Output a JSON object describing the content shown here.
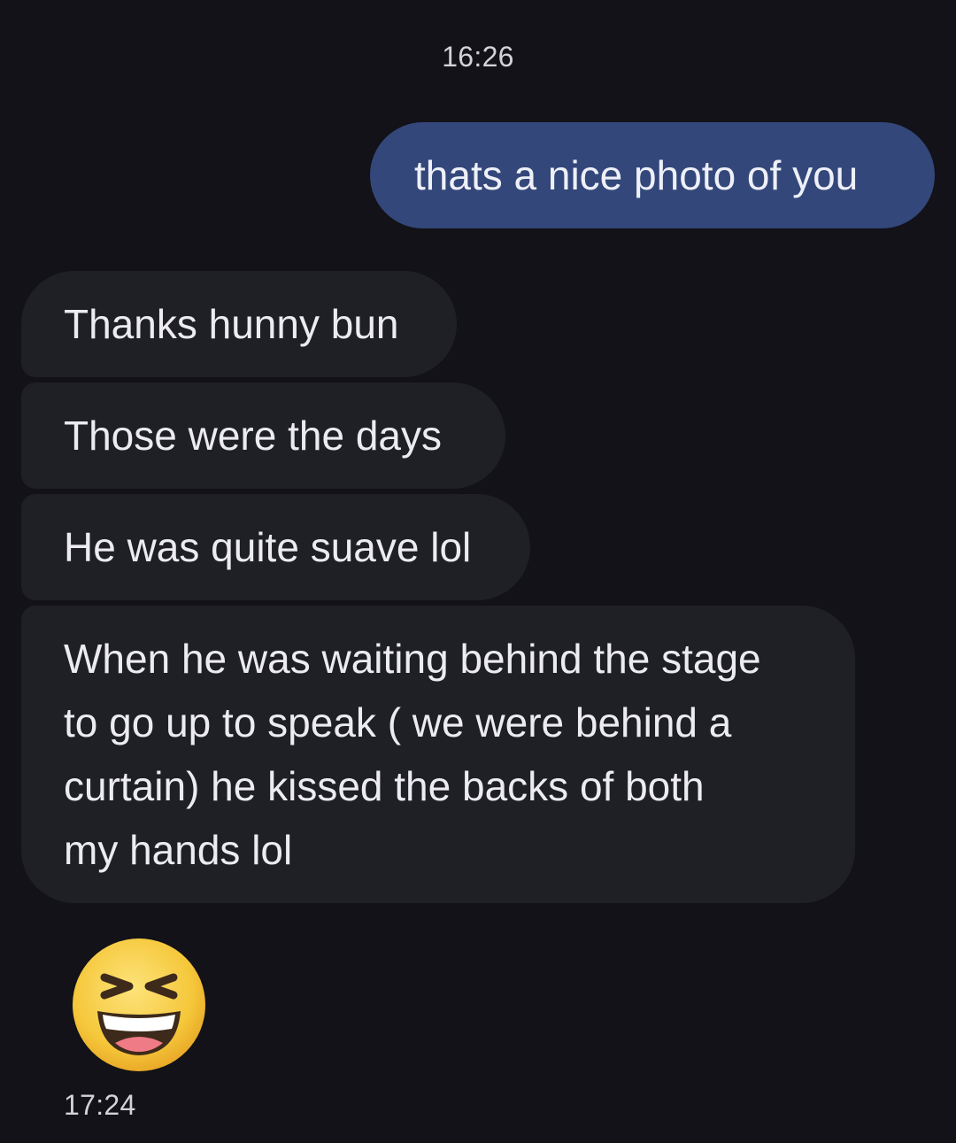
{
  "conversation": {
    "timestamp_top": "16:26",
    "timestamp_bottom": "17:24",
    "messages": [
      {
        "direction": "outgoing",
        "text": "thats a nice photo of you"
      },
      {
        "direction": "incoming",
        "text": "Thanks hunny bun"
      },
      {
        "direction": "incoming",
        "text": "Those were the days"
      },
      {
        "direction": "incoming",
        "text": "He was quite suave lol"
      },
      {
        "direction": "incoming",
        "lines": [
          "When he was waiting behind the stage",
          "to go up to speak ( we were behind a",
          "curtain) he kissed the backs of both",
          "my hands lol"
        ]
      },
      {
        "direction": "incoming",
        "emoji": "grinning-squinting-face-icon"
      }
    ]
  },
  "colors": {
    "background": "#121218",
    "outgoing_bubble": "#34477a",
    "incoming_bubble": "#1f1f26",
    "text": "#ececf0"
  }
}
